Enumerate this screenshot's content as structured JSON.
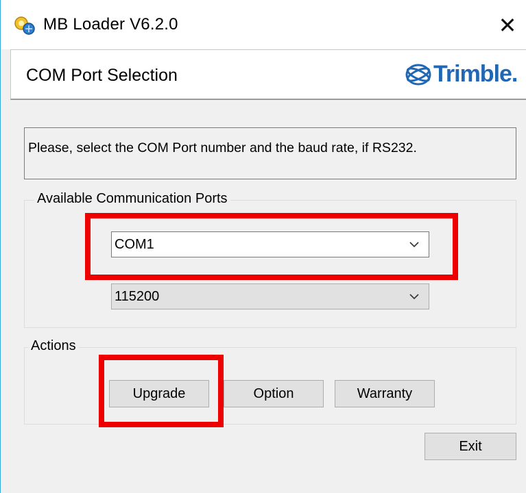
{
  "window": {
    "title": "MB Loader V6.2.0",
    "close_label": "✕"
  },
  "header": {
    "title": "COM Port Selection",
    "brand": "Trimble."
  },
  "message": "Please, select the COM Port number and the baud rate, if RS232.",
  "ports_group": {
    "label": "Available Communication Ports",
    "com_port": "COM1",
    "baud_rate": "115200"
  },
  "actions_group": {
    "label": "Actions",
    "upgrade_label": "Upgrade",
    "option_label": "Option",
    "warranty_label": "Warranty"
  },
  "exit_label": "Exit",
  "colors": {
    "highlight": "#ee0000",
    "brand": "#2167b3",
    "window_border": "#38a8d8"
  },
  "icons": {
    "app": "satellite-loader-icon",
    "brand": "trimble-globe-logo",
    "dropdown": "chevron-down-icon"
  }
}
